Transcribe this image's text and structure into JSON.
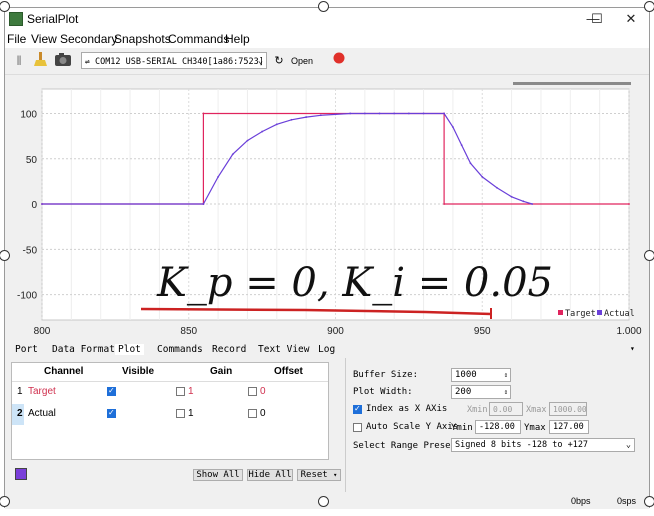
{
  "window": {
    "title": "SerialPlot"
  },
  "menu": [
    "File",
    "View",
    "Secondary",
    "Snapshots",
    "Commands",
    "Help"
  ],
  "toolbar": {
    "port": "COM12 USB-SERIAL CH340[1a86:7523]",
    "refresh_icon": "↻",
    "open_label": "Open"
  },
  "plot": {
    "annotation": "K_p = 0, K_i = 0.05",
    "legend": [
      "Target",
      "Actual"
    ],
    "colors": {
      "target": "#e0245e",
      "actual": "#6a3fd9",
      "annotation_line": "#cc2222"
    }
  },
  "chart_data": {
    "type": "line",
    "xlim": [
      800,
      1000
    ],
    "ylim": [
      -128,
      127
    ],
    "x_ticks": [
      "800",
      "850",
      "900",
      "950",
      "1.000"
    ],
    "y_ticks": [
      "100",
      "50",
      "0",
      "-50",
      "-100"
    ],
    "grid": true,
    "legend_position": "bottom-right",
    "series": [
      {
        "name": "Target",
        "points": [
          [
            800,
            0
          ],
          [
            855,
            0
          ],
          [
            855,
            100
          ],
          [
            937,
            100
          ],
          [
            937,
            0
          ],
          [
            1000,
            0
          ]
        ]
      },
      {
        "name": "Actual",
        "points": [
          [
            800,
            0
          ],
          [
            855,
            0
          ],
          [
            860,
            30
          ],
          [
            865,
            55
          ],
          [
            870,
            70
          ],
          [
            875,
            80
          ],
          [
            880,
            88
          ],
          [
            885,
            93
          ],
          [
            890,
            96
          ],
          [
            895,
            98
          ],
          [
            900,
            99
          ],
          [
            905,
            100
          ],
          [
            910,
            100
          ],
          [
            915,
            100
          ],
          [
            920,
            100
          ],
          [
            925,
            100
          ],
          [
            930,
            100
          ],
          [
            937,
            100
          ],
          [
            940,
            85
          ],
          [
            943,
            65
          ],
          [
            946,
            45
          ],
          [
            950,
            30
          ],
          [
            955,
            18
          ],
          [
            960,
            8
          ],
          [
            964,
            3
          ],
          [
            967,
            0
          ]
        ]
      }
    ]
  },
  "tabs": [
    "Port",
    "Data Format",
    "Plot",
    "Commands",
    "Record",
    "Text View",
    "Log"
  ],
  "channels": {
    "headers": [
      "Channel",
      "Visible",
      "Gain",
      "Offset"
    ],
    "rows": [
      {
        "index": "1",
        "name": "Target",
        "visible": true,
        "gain": "1",
        "offset": "0"
      },
      {
        "index": "2",
        "name": "Actual",
        "visible": true,
        "gain": "1",
        "offset": "0"
      }
    ],
    "buttons": [
      "Show All",
      "Hide All",
      "Reset"
    ]
  },
  "settings": {
    "buffer_size_label": "Buffer Size:",
    "buffer_size": "1000",
    "plot_width_label": "Plot Width:",
    "plot_width": "200",
    "index_x_label": "Index as X AXis",
    "xmin_label": "Xmin",
    "xmin": "0.00",
    "xmax_label": "Xmax",
    "xmax": "1000.00",
    "autoscale_label": "Auto Scale Y Axis",
    "ymin_label": "Ymin",
    "ymin": "-128.00",
    "ymax_label": "Ymax",
    "ymax": "127.00",
    "preset_label": "Select Range Preset:",
    "preset": "Signed 8 bits -128 to +127"
  },
  "status": {
    "rate1": "0bps",
    "rate2": "0sps"
  }
}
